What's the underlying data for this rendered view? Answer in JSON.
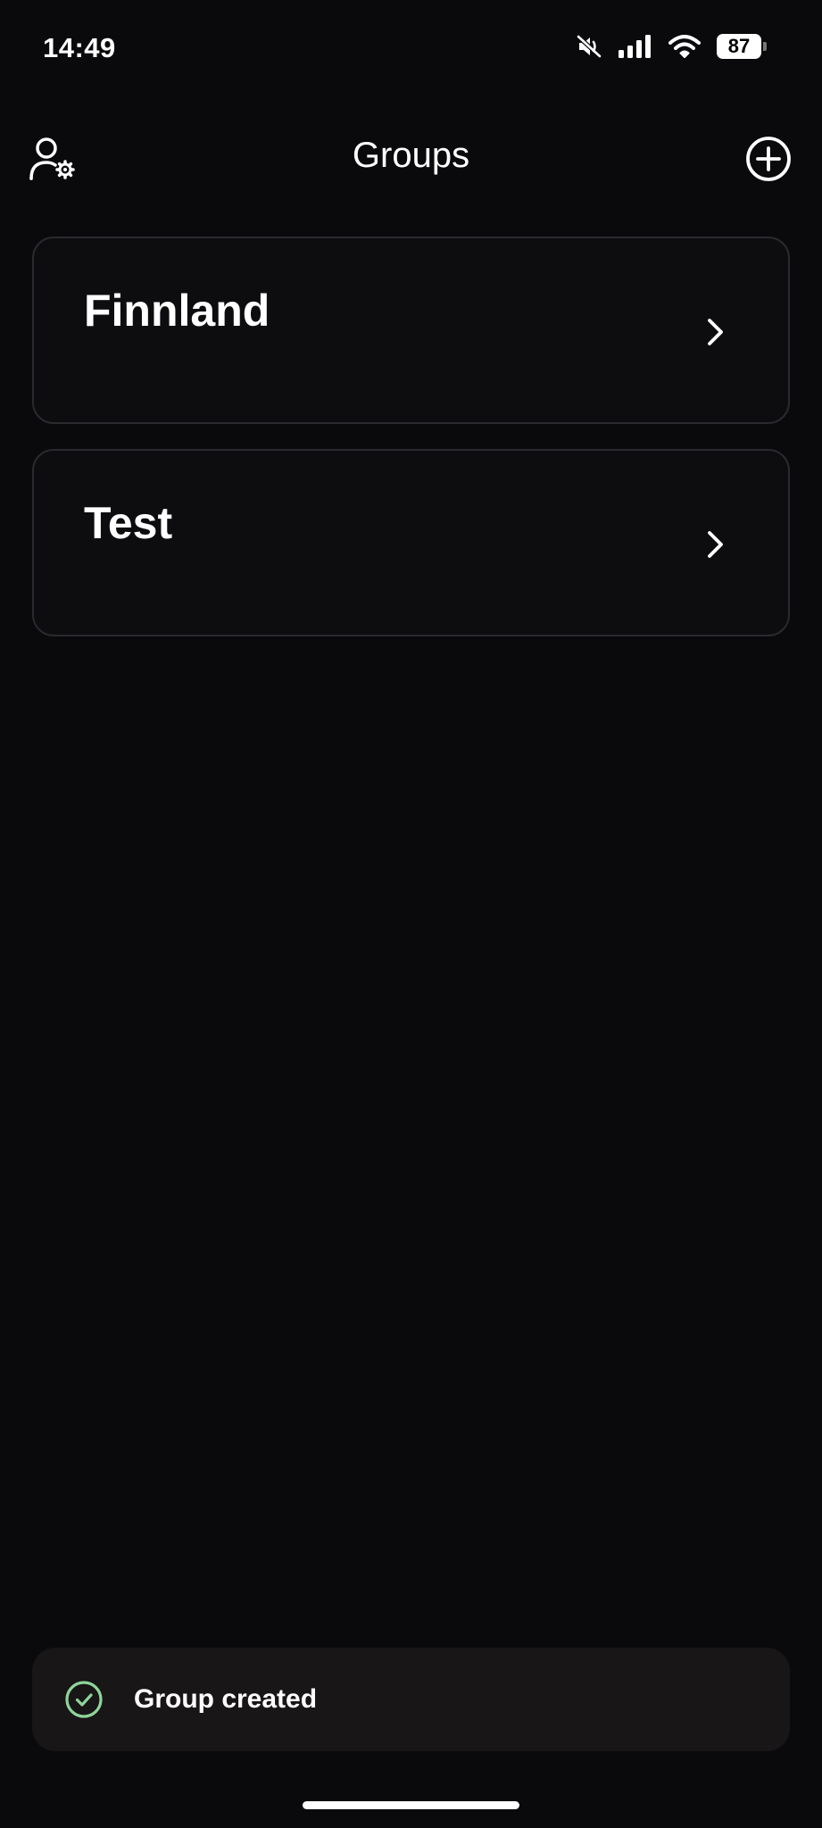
{
  "status_bar": {
    "time": "14:49",
    "battery_level": "87",
    "icons": [
      "mute-icon",
      "cellular-signal-icon",
      "wifi-icon",
      "battery-icon"
    ]
  },
  "header": {
    "title": "Groups",
    "left_icon": "user-settings-icon",
    "right_icon": "add-circle-icon"
  },
  "groups": [
    {
      "name": "Finnland"
    },
    {
      "name": "Test"
    }
  ],
  "toast": {
    "message": "Group created",
    "icon": "check-circle-icon",
    "icon_color": "#8fd49a"
  },
  "colors": {
    "background": "#0a0a0c",
    "card_border": "#2a2a2e",
    "toast_background": "#181617"
  }
}
